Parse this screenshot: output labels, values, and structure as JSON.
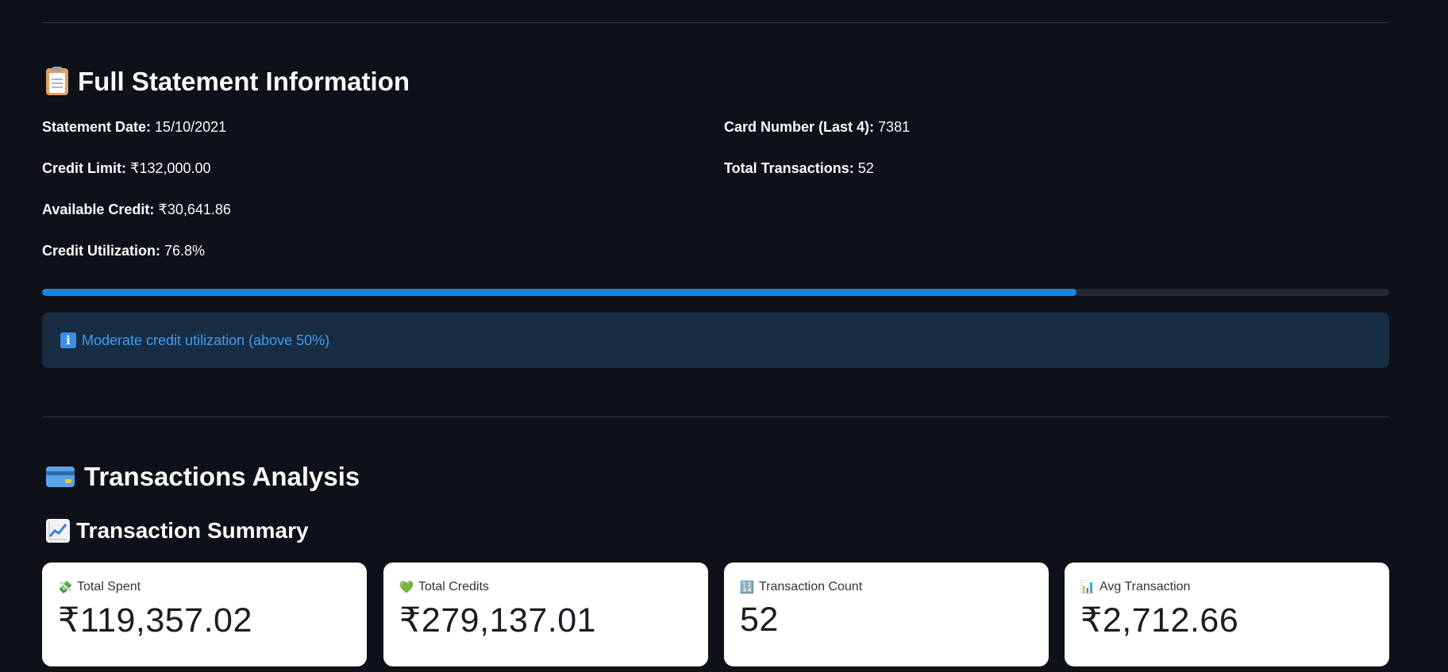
{
  "statement_section": {
    "title": "Full Statement Information",
    "icon": "clipboard-icon",
    "fields": {
      "statement_date_label": "Statement Date:",
      "statement_date_value": "15/10/2021",
      "card_number_label": "Card Number (Last 4):",
      "card_number_value": "7381",
      "credit_limit_label": "Credit Limit:",
      "credit_limit_value": "₹132,000.00",
      "total_transactions_label": "Total Transactions:",
      "total_transactions_value": "52",
      "available_credit_label": "Available Credit:",
      "available_credit_value": "₹30,641.86",
      "credit_utilization_label": "Credit Utilization:",
      "credit_utilization_value": "76.8%"
    },
    "utilization_progress": 0.768,
    "info_message": "Moderate credit utilization (above 50%)"
  },
  "transactions_section": {
    "title": "Transactions Analysis",
    "icon": "credit-card-icon",
    "summary_title": "Transaction Summary",
    "summary_icon": "chart-increasing-icon",
    "metrics": [
      {
        "label": "Total Spent",
        "value": "₹119,357.02",
        "icon": "money-with-wings-icon",
        "emoji": "💸"
      },
      {
        "label": "Total Credits",
        "value": "₹279,137.01",
        "icon": "green-heart-icon",
        "emoji": "💚"
      },
      {
        "label": "Transaction Count",
        "value": "52",
        "icon": "input-numbers-icon",
        "emoji": "🔢"
      },
      {
        "label": "Avg Transaction",
        "value": "₹2,712.66",
        "icon": "bar-chart-icon",
        "emoji": "📊"
      }
    ]
  },
  "colors": {
    "background": "#0e1117",
    "progress_fill": "#1c83e1",
    "info_bg": "#172d43",
    "info_text": "#3d9df3",
    "card_bg": "#ffffff"
  }
}
